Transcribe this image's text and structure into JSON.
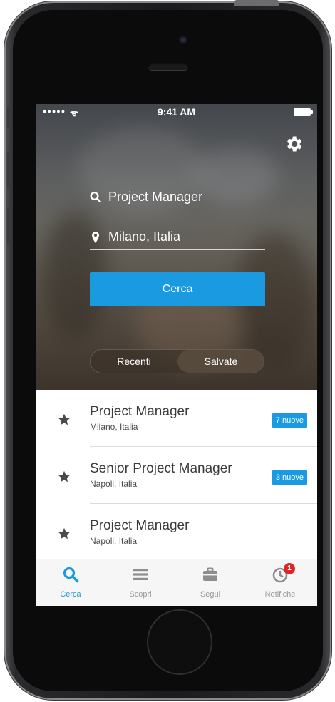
{
  "status_bar": {
    "time": "9:41 AM"
  },
  "search": {
    "query": "Project Manager",
    "location": "Milano, Italia",
    "button_label": "Cerca"
  },
  "segment": {
    "left_label": "Recenti",
    "right_label": "Salvate",
    "selected": "Salvate"
  },
  "saved_searches": [
    {
      "title": "Project Manager",
      "location": "Milano, Italia",
      "badge": "7 nuove"
    },
    {
      "title": "Senior Project Manager",
      "location": "Napoli, Italia",
      "badge": "3 nuove"
    },
    {
      "title": "Project Manager",
      "location": "Napoli, Italia",
      "badge": ""
    }
  ],
  "tabs": [
    {
      "label": "Cerca",
      "icon": "search-icon",
      "active": true
    },
    {
      "label": "Scopri",
      "icon": "list-icon",
      "active": false
    },
    {
      "label": "Segui",
      "icon": "briefcase-icon",
      "active": false
    },
    {
      "label": "Notifiche",
      "icon": "clock-icon",
      "active": false,
      "badge": "1"
    }
  ],
  "colors": {
    "accent": "#1a9ae0",
    "badge_red": "#e02424",
    "tab_inactive": "#9a9a9a"
  }
}
